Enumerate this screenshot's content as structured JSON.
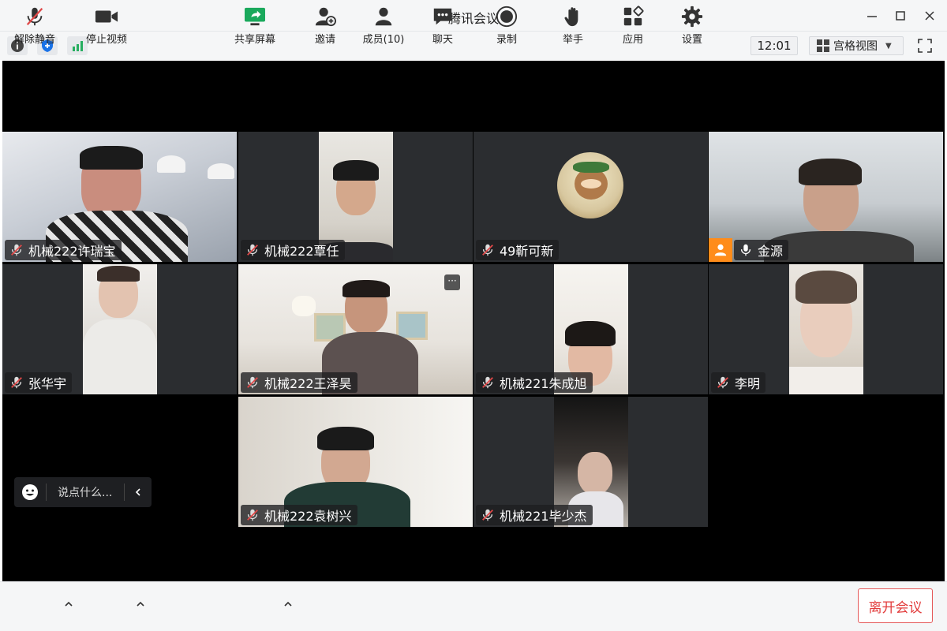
{
  "window": {
    "title": "腾讯会议"
  },
  "subbar": {
    "time": "12:01",
    "view_label": "宫格视图"
  },
  "participants": [
    {
      "name": "机械222许瑞宝",
      "mic": "muted"
    },
    {
      "name": "机械222覃任",
      "mic": "muted"
    },
    {
      "name": "49靳可新",
      "mic": "muted"
    },
    {
      "name": "金源",
      "mic": "on",
      "host": true
    },
    {
      "name": "张华宇",
      "mic": "muted"
    },
    {
      "name": "机械222王泽昊",
      "mic": "muted"
    },
    {
      "name": "机械221朱成旭",
      "mic": "muted"
    },
    {
      "name": "李明",
      "mic": "muted"
    },
    {
      "name": "机械222袁树兴",
      "mic": "muted"
    },
    {
      "name": "机械221毕少杰",
      "mic": "muted"
    }
  ],
  "more_label": "···",
  "chat": {
    "placeholder": "说点什么..."
  },
  "toolbar": {
    "mute": "解除静音",
    "video": "停止视频",
    "share": "共享屏幕",
    "invite": "邀请",
    "members": "成员(10)",
    "chat": "聊天",
    "record": "录制",
    "raise_hand": "举手",
    "apps": "应用",
    "settings": "设置",
    "leave": "离开会议"
  },
  "colors": {
    "active_speaker": "#2ecc71",
    "host_badge": "#ff8c1a",
    "leave": "#e23c3c",
    "mic_muted": "#e04848"
  }
}
